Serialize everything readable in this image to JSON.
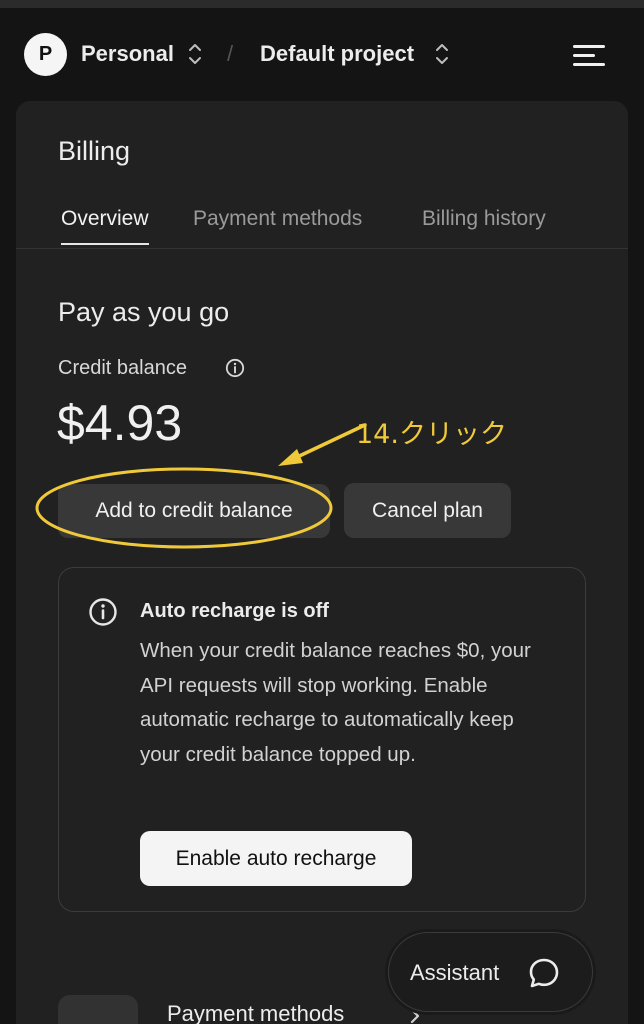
{
  "header": {
    "avatar_letter": "P",
    "org": "Personal",
    "separator": "/",
    "project": "Default project"
  },
  "billing": {
    "title": "Billing",
    "tabs": [
      {
        "label": "Overview",
        "active": true
      },
      {
        "label": "Payment methods",
        "active": false
      },
      {
        "label": "Billing history",
        "active": false
      }
    ],
    "section_title": "Pay as you go",
    "credit_label": "Credit balance",
    "balance": "$4.93",
    "add_button": "Add to credit balance",
    "cancel_button": "Cancel plan",
    "notice": {
      "title": "Auto recharge is off",
      "body": "When your credit balance reaches $0, your API requests will stop working. Enable automatic recharge to automatically keep your credit balance topped up.",
      "button": "Enable auto recharge"
    },
    "payment_methods_link": "Payment methods"
  },
  "annotation": {
    "text": "14.クリック",
    "color": "#f0c93a"
  },
  "assistant": {
    "label": "Assistant"
  },
  "colors": {
    "background": "#141414",
    "panel": "#212121",
    "button": "#383838",
    "accent_annotation": "#f0c93a"
  }
}
